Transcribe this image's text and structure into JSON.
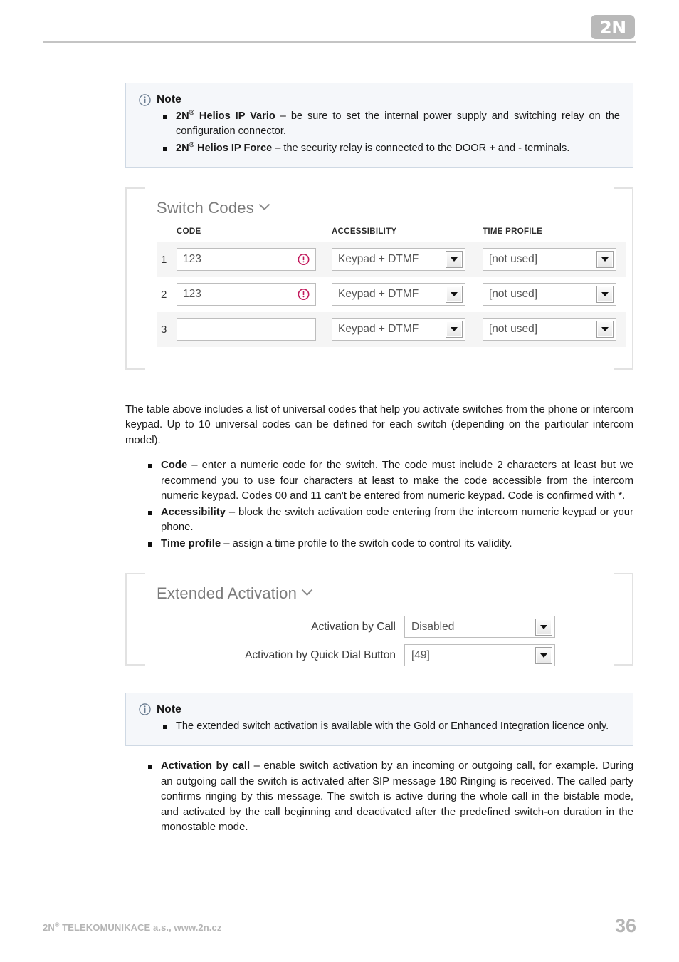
{
  "header": {
    "logo_text": "2N",
    "logo_color": "#b9b9b9"
  },
  "note_top": {
    "icon": "info-circle-icon",
    "title": "Note",
    "items": [
      {
        "bold_prefix": "2N",
        "bold_sup": "®",
        "bold_rest": " Helios IP Vario",
        "text": " – be sure to set the internal power supply and switching relay on the configuration connector."
      },
      {
        "bold_prefix": "2N",
        "bold_sup": "®",
        "bold_rest": " Helios IP Force",
        "text": " – the security relay is connected to the DOOR + and - terminals."
      }
    ]
  },
  "switch_codes_panel": {
    "title": "Switch Codes",
    "collapse_icon": "chevron-down-icon",
    "columns": [
      "CODE",
      "ACCESSIBILITY",
      "TIME PROFILE"
    ],
    "rows": [
      {
        "num": "1",
        "code": "123",
        "code_placeholder": "",
        "has_warning": true,
        "warning_icon": "error-exclamation-icon",
        "accessibility": "Keypad + DTMF",
        "time_profile": "[not used]"
      },
      {
        "num": "2",
        "code": "123",
        "code_placeholder": "",
        "has_warning": true,
        "warning_icon": "error-exclamation-icon",
        "accessibility": "Keypad + DTMF",
        "time_profile": "[not used]"
      },
      {
        "num": "3",
        "code": "",
        "code_placeholder": "",
        "has_warning": false,
        "warning_icon": "",
        "accessibility": "Keypad + DTMF",
        "time_profile": "[not used]"
      }
    ],
    "warning_color": "#c2185b"
  },
  "intro_paragraph": "The table above includes a list of universal codes that help you activate switches from the phone or intercom keypad. Up to 10 universal codes can be defined for each switch (depending on the particular intercom model).",
  "field_descriptions": [
    {
      "term": "Code",
      "desc": " – enter a numeric code for the switch. The code must include 2 characters at least but we recommend you to use four characters at least to make the code accessible from the intercom numeric keypad. Codes 00 and 11 can't be entered from numeric keypad. Code is confirmed with *."
    },
    {
      "term": "Accessibility",
      "desc": " – block the switch activation code entering from the intercom numeric keypad or your phone."
    },
    {
      "term": "Time profile",
      "desc": " – assign a time profile to the switch code to control its validity."
    }
  ],
  "extended_activation_panel": {
    "title": "Extended Activation",
    "collapse_icon": "chevron-down-icon",
    "fields": [
      {
        "label": "Activation by Call",
        "value": "Disabled"
      },
      {
        "label": "Activation by Quick Dial Button",
        "value": "[49]"
      }
    ]
  },
  "note_bottom": {
    "icon": "info-circle-icon",
    "title": "Note",
    "items": [
      {
        "text": "The extended switch activation is available with the Gold or Enhanced Integration licence only."
      }
    ]
  },
  "final_bullet": {
    "term": "Activation by call",
    "desc": " – enable switch activation by an incoming or outgoing call, for example. During an outgoing call the switch is activated after SIP message 180 Ringing is received. The called party confirms ringing by this message. The switch is active during the whole call in the bistable mode, and activated by the call beginning and deactivated after the predefined switch-on duration in the monostable mode."
  },
  "footer": {
    "company_prefix": "2N",
    "company_sup": "®",
    "company_rest": " TELEKOMUNIKACE a.s., www.2n.cz",
    "page_number": "36"
  }
}
